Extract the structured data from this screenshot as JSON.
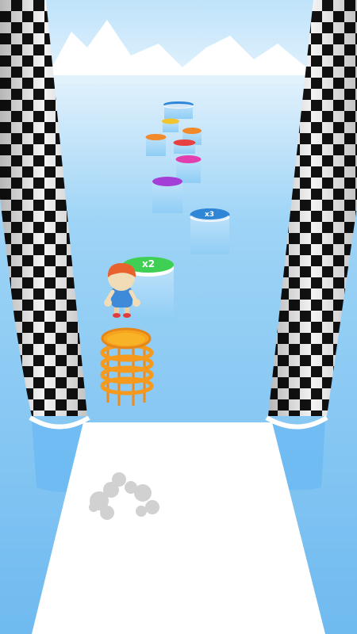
{
  "platforms": [
    {
      "label": "x2",
      "color": "#3fcf55"
    },
    {
      "label": "x3",
      "color": "#2f86d6"
    },
    {
      "label": "",
      "color": "#a33fd6"
    },
    {
      "label": "",
      "color": "#e23fae"
    },
    {
      "label": "",
      "color": "#e84040"
    },
    {
      "label": "",
      "color": "#f08a2a"
    },
    {
      "label": "",
      "color": "#f08a2a"
    },
    {
      "label": "",
      "color": "#f2c52e"
    },
    {
      "label": "",
      "color": "#2f86d6"
    }
  ],
  "colors": {
    "sky_top": "#d8ecfb",
    "water": "#8fcff5",
    "runway": "#ffffff",
    "stack": "#f59a1c",
    "player_shirt": "#3f8ad8",
    "player_hair": "#e8622d"
  },
  "checker_pillar_left": "checkered-pillar",
  "checker_pillar_right": "checkered-pillar"
}
